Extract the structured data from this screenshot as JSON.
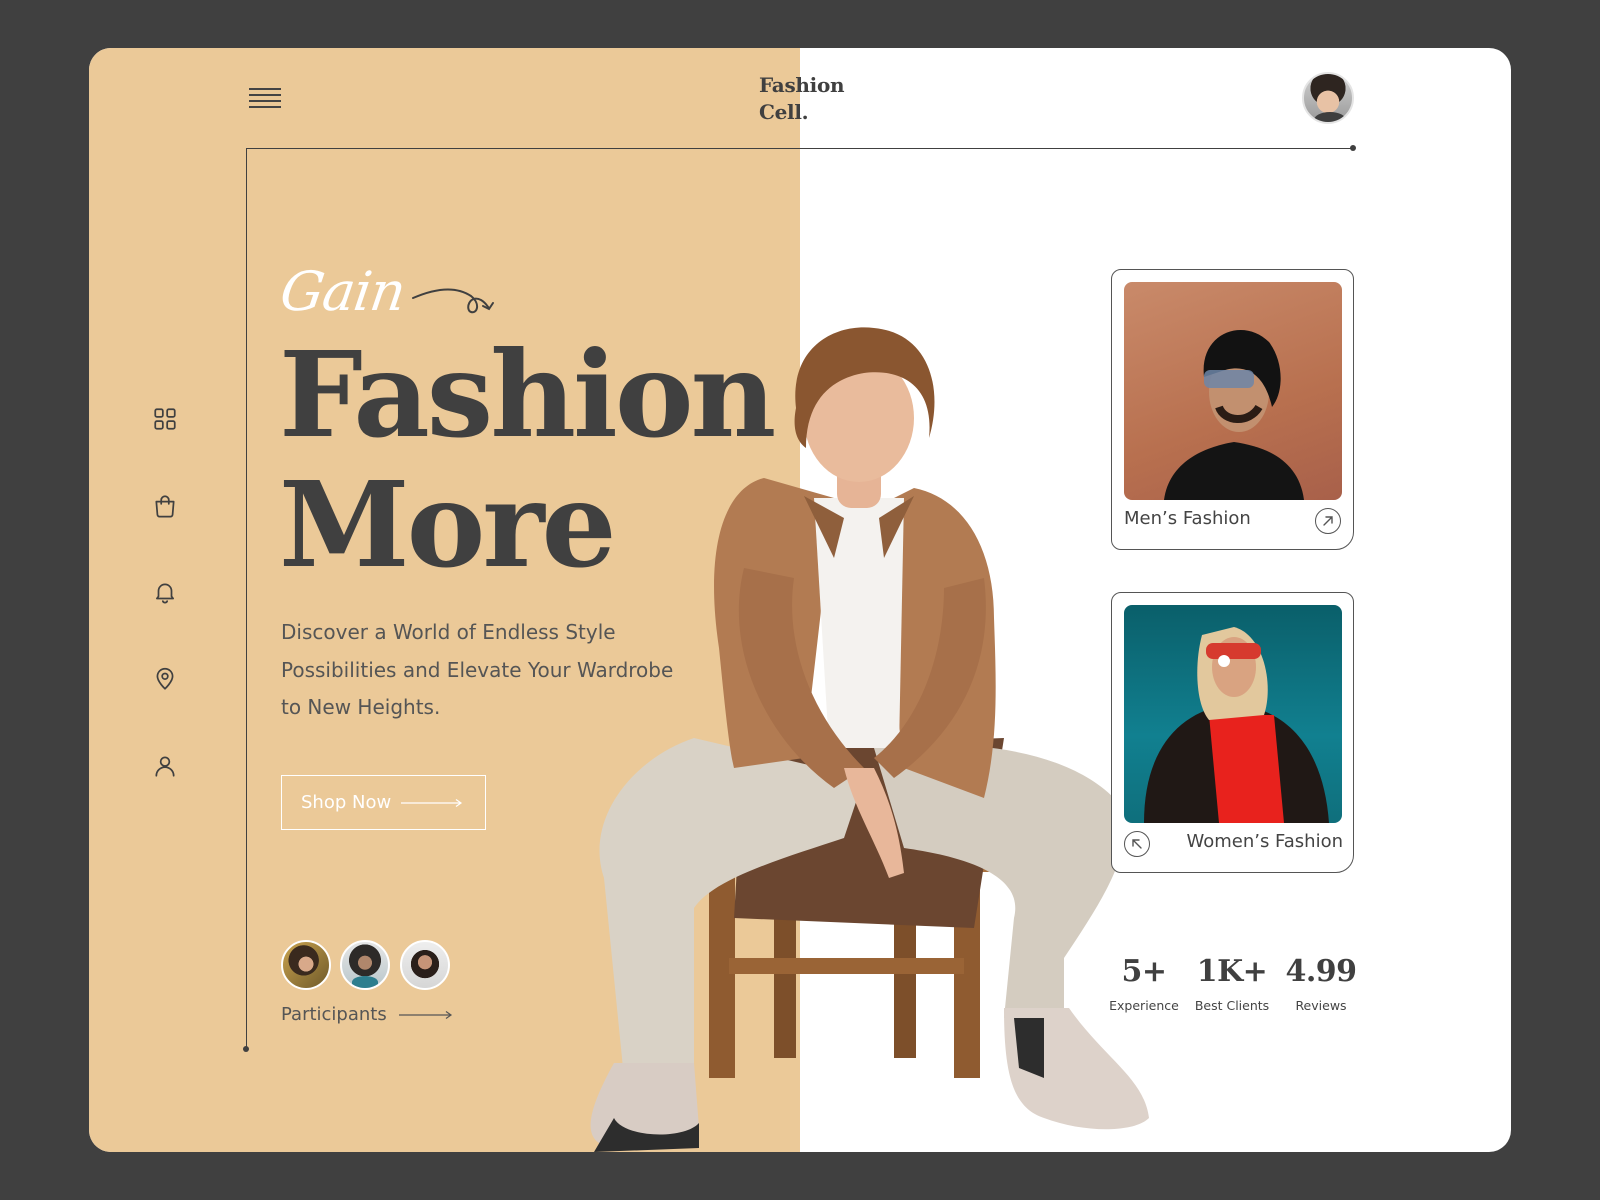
{
  "header": {
    "brand_line1": "Fashion",
    "brand_line2": "Cell.",
    "menu_icon": "hamburger-menu-icon",
    "profile_avatar": "user-profile-avatar"
  },
  "sidebar": {
    "items": [
      {
        "icon": "grid-icon",
        "name": "dashboard"
      },
      {
        "icon": "shopping-bag-icon",
        "name": "shop"
      },
      {
        "icon": "bell-icon",
        "name": "notifications"
      },
      {
        "icon": "location-pin-icon",
        "name": "location"
      },
      {
        "icon": "user-icon",
        "name": "profile"
      }
    ]
  },
  "hero": {
    "script_word": "Gain",
    "title_line1": "Fashion",
    "title_line2": "More",
    "description": "Discover a World of Endless Style Possibilities and Elevate Your Wardrobe to New Heights.",
    "cta_label": "Shop Now",
    "participants_label": "Participants",
    "participant_count": 3
  },
  "categories": [
    {
      "label": "Men’s Fashion",
      "arrow_icon": "arrow-up-right-icon"
    },
    {
      "label": "Women’s Fashion",
      "arrow_icon": "arrow-up-left-icon"
    }
  ],
  "stats": [
    {
      "value": "5+",
      "label": "Experience"
    },
    {
      "value": "1K+",
      "label": "Best Clients"
    },
    {
      "value": "4.99",
      "label": "Reviews"
    }
  ],
  "colors": {
    "panel_tan": "#EBC998",
    "text_dark": "#404040",
    "background": "#404040",
    "card_bg": "#ffffff"
  }
}
